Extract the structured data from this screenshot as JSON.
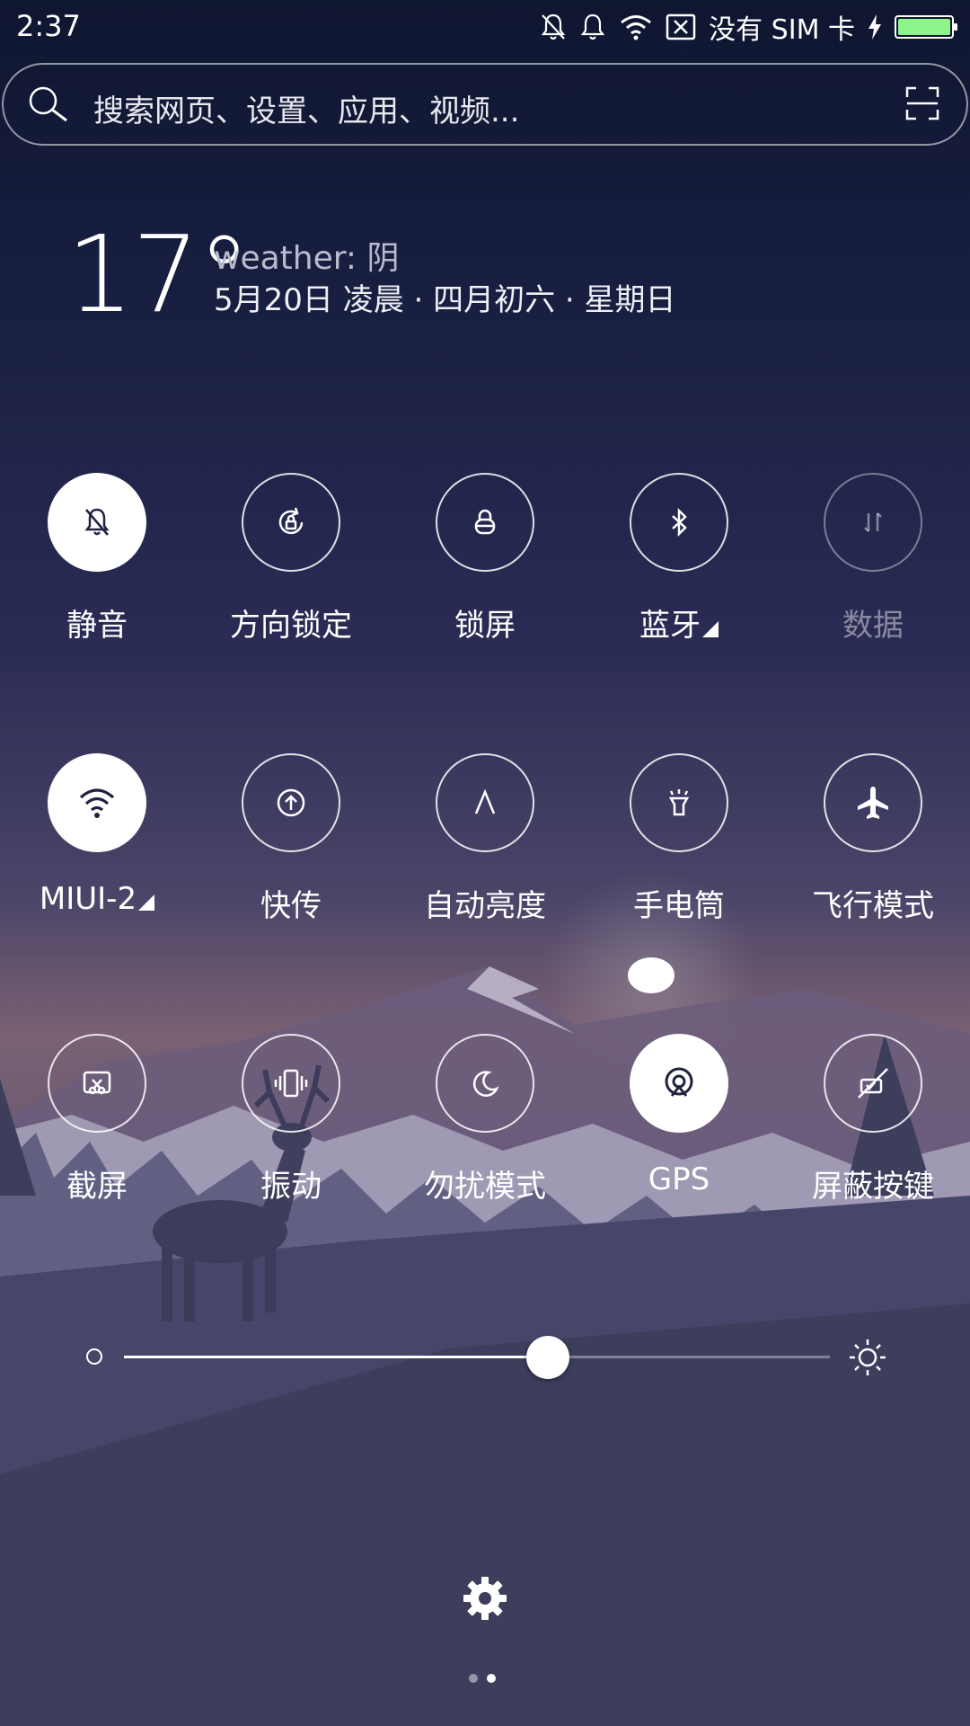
{
  "status_bar": {
    "time": "2:37",
    "carrier": "没有 SIM 卡",
    "battery_level": 1.0,
    "battery_color": "#8df58a",
    "icons": [
      "silent-bell-icon",
      "bell-icon",
      "wifi-icon",
      "no-sim-icon",
      "charging-icon",
      "battery-icon"
    ]
  },
  "search": {
    "placeholder": "搜索网页、设置、应用、视频..."
  },
  "weather": {
    "temperature": "17°",
    "condition_line": "weather: 阴",
    "date_line": "5月20日 凌晨 · 四月初六 · 星期日"
  },
  "toggles": [
    {
      "label": "静音",
      "icon": "silent-icon",
      "state": "on"
    },
    {
      "label": "方向锁定",
      "icon": "rotation-lock-icon",
      "state": "off"
    },
    {
      "label": "锁屏",
      "icon": "lock-icon",
      "state": "off"
    },
    {
      "label": "蓝牙",
      "icon": "bluetooth-icon",
      "state": "off",
      "has_menu": true
    },
    {
      "label": "数据",
      "icon": "mobile-data-icon",
      "state": "disabled"
    },
    {
      "label": "MIUI-2",
      "icon": "wifi-icon",
      "state": "on",
      "has_menu": true
    },
    {
      "label": "快传",
      "icon": "quick-transfer-icon",
      "state": "off"
    },
    {
      "label": "自动亮度",
      "icon": "auto-brightness-icon",
      "state": "off"
    },
    {
      "label": "手电筒",
      "icon": "flashlight-icon",
      "state": "off"
    },
    {
      "label": "飞行模式",
      "icon": "airplane-icon",
      "state": "off"
    },
    {
      "label": "截屏",
      "icon": "screenshot-icon",
      "state": "off"
    },
    {
      "label": "振动",
      "icon": "vibrate-icon",
      "state": "off"
    },
    {
      "label": "勿扰模式",
      "icon": "moon-icon",
      "state": "off"
    },
    {
      "label": "GPS",
      "icon": "gps-icon",
      "state": "on"
    },
    {
      "label": "屏蔽按键",
      "icon": "block-keys-icon",
      "state": "off"
    }
  ],
  "brightness": {
    "level": 0.6
  },
  "pager": {
    "count": 2,
    "active": 1
  }
}
